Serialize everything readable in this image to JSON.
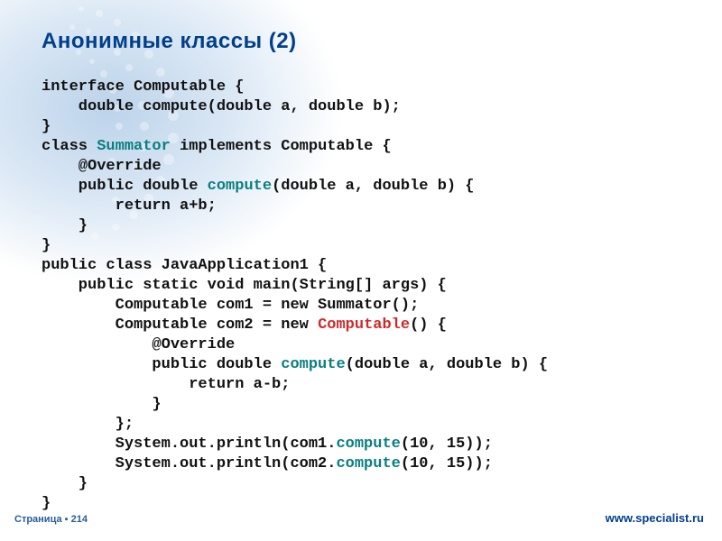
{
  "slide": {
    "title": "Анонимные классы (2)",
    "footer_left": "Страница ▪ 214",
    "footer_right": "www.specialist.ru"
  },
  "code": {
    "l01_a": "interface Computable {",
    "l02_a": "    double compute(double a, double b);",
    "l03_a": "}",
    "l04_a": "class ",
    "l04_b": "Summator",
    "l04_c": " implements Computable {",
    "l05_a": "    @Override",
    "l06_a": "    public double ",
    "l06_b": "compute",
    "l06_c": "(double a, double b) {",
    "l07_a": "        return a+b;",
    "l08_a": "    }",
    "l09_a": "}",
    "l10_a": "public class JavaApplication1 {",
    "l11_a": "    public static void main(String[] args) {",
    "l12_a": "        Computable com1 = new Summator();",
    "l13_a": "        Computable com2 = new ",
    "l13_b": "Computable",
    "l13_c": "() {",
    "l14_a": "            @Override",
    "l15_a": "            public double ",
    "l15_b": "compute",
    "l15_c": "(double a, double b) {",
    "l16_a": "                return a-b;",
    "l17_a": "            }",
    "l18_a": "        };",
    "l19_a": "        System.out.println(com1.",
    "l19_b": "compute",
    "l19_c": "(10, 15));",
    "l20_a": "        System.out.println(com2.",
    "l20_b": "compute",
    "l20_c": "(10, 15));",
    "l21_a": "    }",
    "l22_a": "}"
  }
}
